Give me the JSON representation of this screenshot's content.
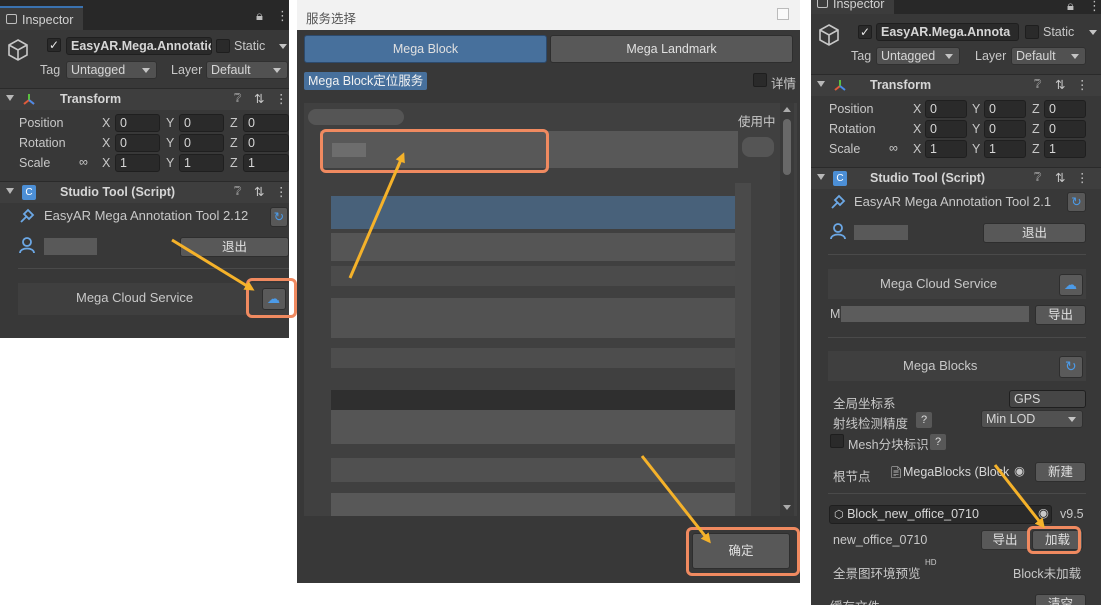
{
  "left_panel": {
    "tab_title": "Inspector",
    "object_name": "EasyAR.Mega.Annotatio",
    "static_label": "Static",
    "tag_label": "Tag",
    "tag_value": "Untagged",
    "layer_label": "Layer",
    "layer_value": "Default",
    "transform_title": "Transform",
    "rows": [
      {
        "label": "Position",
        "x": "0",
        "y": "0",
        "z": "0"
      },
      {
        "label": "Rotation",
        "x": "0",
        "y": "0",
        "z": "0"
      },
      {
        "label": "Scale",
        "x": "1",
        "y": "1",
        "z": "1"
      }
    ],
    "axis": {
      "x": "X",
      "y": "Y",
      "z": "Z"
    },
    "script_title": "Studio Tool (Script)",
    "tool_name": "EasyAR Mega Annotation Tool 2.12",
    "logout_label": "退出",
    "cloud_service_label": "Mega Cloud Service"
  },
  "dialog": {
    "title": "服务选择",
    "tab_block": "Mega Block",
    "tab_landmark": "Mega Landmark",
    "service_badge": "Mega Block定位服务",
    "details_label": "详情",
    "in_use_label": "使用中",
    "confirm_label": "确定"
  },
  "right_panel": {
    "tab_title": "Inspector",
    "object_name": "EasyAR.Mega.Annota",
    "static_label": "Static",
    "tag_label": "Tag",
    "tag_value": "Untagged",
    "layer_label": "Layer",
    "layer_value": "Default",
    "transform_title": "Transform",
    "rows": [
      {
        "label": "Position",
        "x": "0",
        "y": "0",
        "z": "0"
      },
      {
        "label": "Rotation",
        "x": "0",
        "y": "0",
        "z": "0"
      },
      {
        "label": "Scale",
        "x": "1",
        "y": "1",
        "z": "1"
      }
    ],
    "axis": {
      "x": "X",
      "y": "Y",
      "z": "Z"
    },
    "script_title": "Studio Tool (Script)",
    "tool_name": "EasyAR Mega Annotation Tool 2.1",
    "logout_label": "退出",
    "cloud_service_label": "Mega Cloud Service",
    "m_label": "M",
    "export_label": "导出",
    "mega_blocks_label": "Mega Blocks",
    "global_coord_label": "全局坐标系",
    "global_coord_value": "GPS",
    "raycast_label": "射线检测精度",
    "raycast_value": "Min LOD",
    "mesh_label": "Mesh分块标识",
    "question": "?",
    "root_label": "根节点",
    "root_value": "MegaBlocks (Block",
    "new_label": "新建",
    "block_field": "Block_new_office_0710",
    "version": "v9.5",
    "block_name": "new_office_0710",
    "export2_label": "导出",
    "load_label": "加载",
    "panorama_label": "全景图环境预览",
    "hd_label": "HD",
    "not_loaded": "Block未加载",
    "cache_label": "缓存文件",
    "clear_label": "清空"
  },
  "colors": {
    "highlight": "#f08a60",
    "arrow": "#f5b22a",
    "accent": "#3a72b0"
  }
}
